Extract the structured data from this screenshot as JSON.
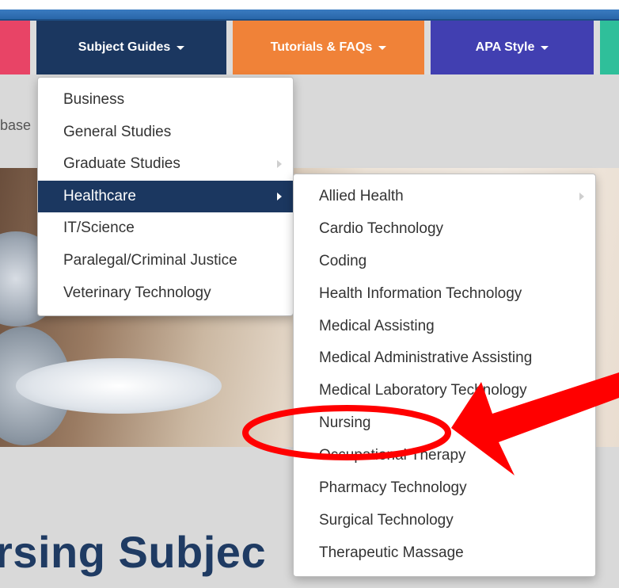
{
  "nav": {
    "tabs": [
      {
        "label": ""
      },
      {
        "label": "Subject Guides"
      },
      {
        "label": "Tutorials & FAQs"
      },
      {
        "label": "APA Style"
      },
      {
        "label": ""
      }
    ]
  },
  "breadcrumb": {
    "text": "base"
  },
  "page": {
    "heading": "rsing Subjec"
  },
  "subject_menu": {
    "items": [
      {
        "label": "Business"
      },
      {
        "label": "General Studies"
      },
      {
        "label": "Graduate Studies"
      },
      {
        "label": "Healthcare"
      },
      {
        "label": "IT/Science"
      },
      {
        "label": "Paralegal/Criminal Justice"
      },
      {
        "label": "Veterinary Technology"
      }
    ]
  },
  "healthcare_menu": {
    "items": [
      {
        "label": "Allied Health"
      },
      {
        "label": "Cardio Technology"
      },
      {
        "label": "Coding"
      },
      {
        "label": "Health Information Technology"
      },
      {
        "label": "Medical Assisting"
      },
      {
        "label": "Medical Administrative Assisting"
      },
      {
        "label": "Medical Laboratory Technology"
      },
      {
        "label": "Nursing"
      },
      {
        "label": "Occupational Therapy"
      },
      {
        "label": "Pharmacy Technology"
      },
      {
        "label": "Surgical Technology"
      },
      {
        "label": "Therapeutic Massage"
      }
    ]
  },
  "colors": {
    "nav_dark_blue": "#1b3760",
    "nav_orange": "#f08238",
    "nav_purple": "#413fb1",
    "nav_pink": "#e84466",
    "nav_teal": "#2fbf9a",
    "annotation_red": "#ff0000"
  },
  "icons": {
    "dropdown": "caret-down-icon",
    "submenu": "caret-right-icon"
  }
}
